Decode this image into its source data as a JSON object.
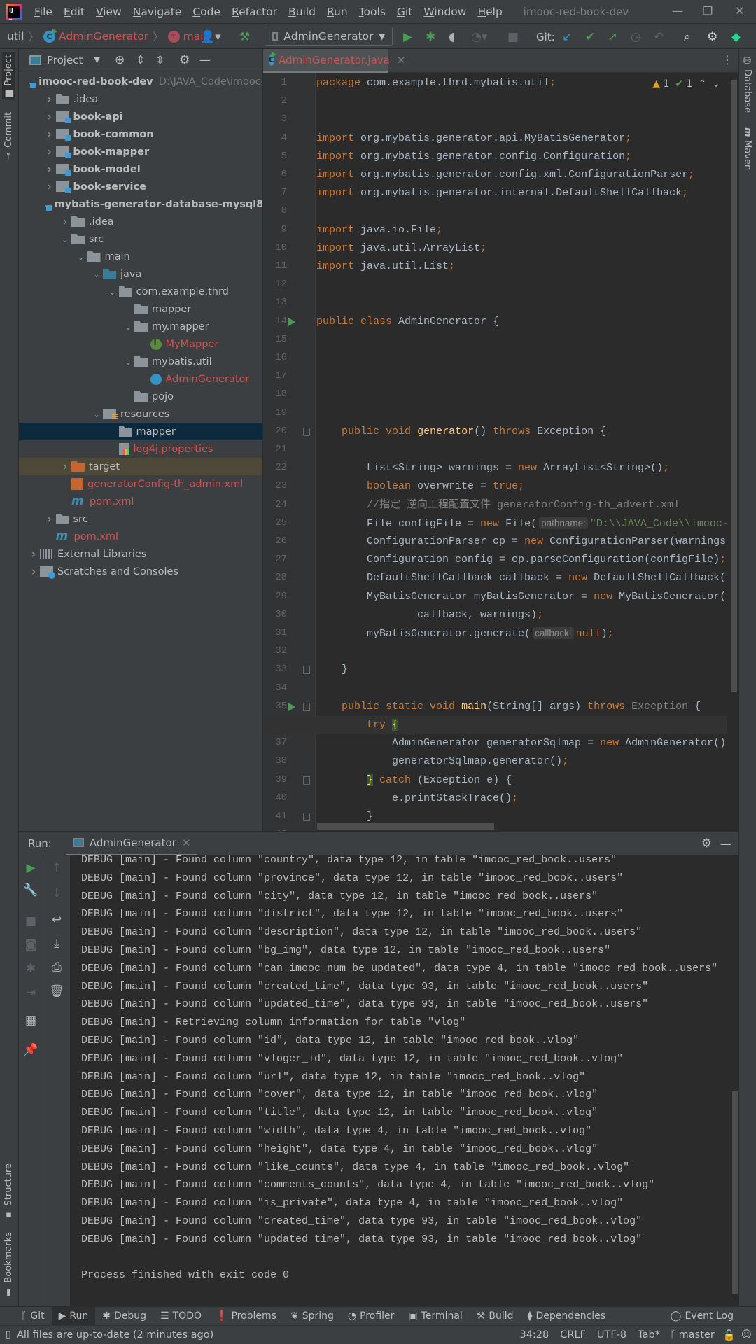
{
  "window": {
    "title": "imooc-red-book-dev"
  },
  "menu": [
    "File",
    "Edit",
    "View",
    "Navigate",
    "Code",
    "Refactor",
    "Build",
    "Run",
    "Tools",
    "Git",
    "Window",
    "Help"
  ],
  "breadcrumb": {
    "package": "util",
    "class": "AdminGenerator",
    "method": "main"
  },
  "toolbar": {
    "run_config": "AdminGenerator",
    "git_label": "Git:"
  },
  "left_stripe": {
    "project": "Project",
    "commit": "Commit",
    "structure": "Structure",
    "bookmarks": "Bookmarks"
  },
  "right_stripe": {
    "database": "Database",
    "maven": "Maven"
  },
  "project_panel": {
    "title": "Project",
    "tree": [
      {
        "label": "imooc-red-book-dev",
        "hint": "D:\\JAVA_Code\\imooc-red-book-dev",
        "level": 0,
        "arrow": "open",
        "icon": "root",
        "style": "bold"
      },
      {
        "label": ".idea",
        "level": 1,
        "arrow": "closed",
        "icon": "folder"
      },
      {
        "label": "book-api",
        "level": 1,
        "arrow": "closed",
        "icon": "module",
        "style": "bold"
      },
      {
        "label": "book-common",
        "level": 1,
        "arrow": "closed",
        "icon": "module",
        "style": "bold"
      },
      {
        "label": "book-mapper",
        "level": 1,
        "arrow": "closed",
        "icon": "module",
        "style": "bold"
      },
      {
        "label": "book-model",
        "level": 1,
        "arrow": "closed",
        "icon": "module",
        "style": "bold"
      },
      {
        "label": "book-service",
        "level": 1,
        "arrow": "closed",
        "icon": "module",
        "style": "bold"
      },
      {
        "label": "mybatis-generator-database-mysql8",
        "level": 1,
        "arrow": "open",
        "icon": "module",
        "style": "bold"
      },
      {
        "label": ".idea",
        "level": 2,
        "arrow": "closed",
        "icon": "folder"
      },
      {
        "label": "src",
        "level": 2,
        "arrow": "open",
        "icon": "folder"
      },
      {
        "label": "main",
        "level": 3,
        "arrow": "open",
        "icon": "folder"
      },
      {
        "label": "java",
        "level": 4,
        "arrow": "open",
        "icon": "src"
      },
      {
        "label": "com.example.thrd",
        "level": 5,
        "arrow": "open",
        "icon": "pkg"
      },
      {
        "label": "mapper",
        "level": 6,
        "arrow": "none",
        "icon": "pkg"
      },
      {
        "label": "my.mapper",
        "level": 6,
        "arrow": "open",
        "icon": "pkg"
      },
      {
        "label": "MyMapper",
        "level": 7,
        "arrow": "none",
        "icon": "iface",
        "style": "red"
      },
      {
        "label": "mybatis.util",
        "level": 6,
        "arrow": "open",
        "icon": "pkg"
      },
      {
        "label": "AdminGenerator",
        "level": 7,
        "arrow": "none",
        "icon": "cls",
        "style": "red"
      },
      {
        "label": "pojo",
        "level": 6,
        "arrow": "none",
        "icon": "pkg"
      },
      {
        "label": "resources",
        "level": 4,
        "arrow": "open",
        "icon": "res"
      },
      {
        "label": "mapper",
        "level": 5,
        "arrow": "none",
        "icon": "folder",
        "state": "selected"
      },
      {
        "label": "log4j.properties",
        "level": 5,
        "arrow": "none",
        "icon": "props",
        "style": "red"
      },
      {
        "label": "target",
        "level": 2,
        "arrow": "closed",
        "icon": "target",
        "state": "ignored"
      },
      {
        "label": "generatorConfig-th_admin.xml",
        "level": 2,
        "arrow": "none",
        "icon": "xml",
        "style": "red"
      },
      {
        "label": "pom.xml",
        "level": 2,
        "arrow": "none",
        "icon": "maven",
        "style": "red"
      },
      {
        "label": "src",
        "level": 1,
        "arrow": "closed",
        "icon": "folder"
      },
      {
        "label": "pom.xml",
        "level": 1,
        "arrow": "none",
        "icon": "maven",
        "style": "red"
      },
      {
        "label": "External Libraries",
        "level": 0,
        "arrow": "closed",
        "icon": "libs"
      },
      {
        "label": "Scratches and Consoles",
        "level": 0,
        "arrow": "closed",
        "icon": "scratch"
      }
    ]
  },
  "editor": {
    "tab": "AdminGenerator.java",
    "inspections": {
      "warnings": "1",
      "typos": "1"
    },
    "current_line": 36,
    "run_gutter_lines": [
      14,
      35
    ],
    "fold_lines": [
      20,
      33,
      35,
      36,
      39,
      41
    ],
    "lines": [
      [
        [
          "k",
          "package"
        ],
        [
          "t",
          " com.example.thrd.mybatis.util"
        ],
        [
          "k",
          ";"
        ]
      ],
      [],
      [],
      [
        [
          "k",
          "import"
        ],
        [
          "t",
          " org.mybatis.generator.api.MyBatisGenerator"
        ],
        [
          "k",
          ";"
        ]
      ],
      [
        [
          "k",
          "import"
        ],
        [
          "t",
          " org.mybatis.generator.config.Configuration"
        ],
        [
          "k",
          ";"
        ]
      ],
      [
        [
          "k",
          "import"
        ],
        [
          "t",
          " org.mybatis.generator.config.xml.ConfigurationParser"
        ],
        [
          "k",
          ";"
        ]
      ],
      [
        [
          "k",
          "import"
        ],
        [
          "t",
          " org.mybatis.generator.internal.DefaultShellCallback"
        ],
        [
          "k",
          ";"
        ]
      ],
      [],
      [
        [
          "k",
          "import"
        ],
        [
          "t",
          " java.io.File"
        ],
        [
          "k",
          ";"
        ]
      ],
      [
        [
          "k",
          "import"
        ],
        [
          "t",
          " java.util.ArrayList"
        ],
        [
          "k",
          ";"
        ]
      ],
      [
        [
          "k",
          "import"
        ],
        [
          "t",
          " java.util.List"
        ],
        [
          "k",
          ";"
        ]
      ],
      [],
      [],
      [
        [
          "k",
          "public class"
        ],
        [
          "t",
          " AdminGenerator {"
        ]
      ],
      [],
      [],
      [],
      [],
      [],
      [
        [
          "t",
          "    "
        ],
        [
          "k",
          "public void"
        ],
        [
          "t",
          " "
        ],
        [
          "f",
          "generator"
        ],
        [
          "t",
          "() "
        ],
        [
          "k",
          "throws"
        ],
        [
          "t",
          " Exception {"
        ]
      ],
      [],
      [
        [
          "t",
          "        List<String> warnings = "
        ],
        [
          "k",
          "new"
        ],
        [
          "t",
          " ArrayList<String>()"
        ],
        [
          "k",
          ";"
        ]
      ],
      [
        [
          "t",
          "        "
        ],
        [
          "k",
          "boolean"
        ],
        [
          "t",
          " overwrite = "
        ],
        [
          "k",
          "true;"
        ]
      ],
      [
        [
          "c",
          "        //指定 逆向工程配置文件 generatorConfig-th_advert.xml"
        ]
      ],
      [
        [
          "t",
          "        File configFile = "
        ],
        [
          "k",
          "new"
        ],
        [
          "t",
          " File("
        ],
        [
          "h",
          "pathname:"
        ],
        [
          "s",
          "\"D:\\\\JAVA_Code\\\\imooc-red"
        ]
      ],
      [
        [
          "t",
          "        ConfigurationParser cp = "
        ],
        [
          "k",
          "new"
        ],
        [
          "t",
          " ConfigurationParser(warnings)"
        ],
        [
          "k",
          ";"
        ]
      ],
      [
        [
          "t",
          "        Configuration config = cp.parseConfiguration(configFile)"
        ],
        [
          "k",
          ";"
        ]
      ],
      [
        [
          "t",
          "        DefaultShellCallback callback = "
        ],
        [
          "k",
          "new"
        ],
        [
          "t",
          " DefaultShellCallback(overwrite)"
        ]
      ],
      [
        [
          "t",
          "        MyBatisGenerator myBatisGenerator = "
        ],
        [
          "k",
          "new"
        ],
        [
          "t",
          " MyBatisGenerator(config,"
        ]
      ],
      [
        [
          "t",
          "                callback, warnings)"
        ],
        [
          "k",
          ";"
        ]
      ],
      [
        [
          "t",
          "        myBatisGenerator.generate("
        ],
        [
          "h",
          "callback:"
        ],
        [
          "k",
          "null"
        ],
        [
          "t",
          ")"
        ],
        [
          "k",
          ";"
        ]
      ],
      [],
      [
        [
          "t",
          "    }"
        ]
      ],
      [],
      [
        [
          "t",
          "    "
        ],
        [
          "k",
          "public static void"
        ],
        [
          "t",
          " "
        ],
        [
          "f",
          "main"
        ],
        [
          "t",
          "(String[] args) "
        ],
        [
          "k",
          "throws"
        ],
        [
          "g",
          " Exception"
        ],
        [
          "t",
          " {"
        ]
      ],
      [
        [
          "t",
          "        "
        ],
        [
          "k",
          "try"
        ],
        [
          "t",
          " "
        ],
        [
          "y",
          "{"
        ]
      ],
      [
        [
          "t",
          "            AdminGenerator generatorSqlmap = "
        ],
        [
          "k",
          "new"
        ],
        [
          "t",
          " AdminGenerator()"
        ],
        [
          "k",
          ";"
        ]
      ],
      [
        [
          "t",
          "            generatorSqlmap.generator()"
        ],
        [
          "k",
          ";"
        ]
      ],
      [
        [
          "t",
          "        "
        ],
        [
          "y",
          "}"
        ],
        [
          "k",
          " catch"
        ],
        [
          "t",
          " (Exception e) {"
        ]
      ],
      [
        [
          "t",
          "            e.printStackTrace()"
        ],
        [
          "k",
          ";"
        ]
      ],
      [
        [
          "t",
          "        }"
        ]
      ],
      []
    ]
  },
  "run_panel": {
    "label": "Run:",
    "tab": "AdminGenerator",
    "output": [
      "DEBUG [main] - Found column \"country\", data type 12, in table \"imooc_red_book..users\"",
      "DEBUG [main] - Found column \"province\", data type 12, in table \"imooc_red_book..users\"",
      "DEBUG [main] - Found column \"city\", data type 12, in table \"imooc_red_book..users\"",
      "DEBUG [main] - Found column \"district\", data type 12, in table \"imooc_red_book..users\"",
      "DEBUG [main] - Found column \"description\", data type 12, in table \"imooc_red_book..users\"",
      "DEBUG [main] - Found column \"bg_img\", data type 12, in table \"imooc_red_book..users\"",
      "DEBUG [main] - Found column \"can_imooc_num_be_updated\", data type 4, in table \"imooc_red_book..users\"",
      "DEBUG [main] - Found column \"created_time\", data type 93, in table \"imooc_red_book..users\"",
      "DEBUG [main] - Found column \"updated_time\", data type 93, in table \"imooc_red_book..users\"",
      "DEBUG [main] - Retrieving column information for table \"vlog\"",
      "DEBUG [main] - Found column \"id\", data type 12, in table \"imooc_red_book..vlog\"",
      "DEBUG [main] - Found column \"vloger_id\", data type 12, in table \"imooc_red_book..vlog\"",
      "DEBUG [main] - Found column \"url\", data type 12, in table \"imooc_red_book..vlog\"",
      "DEBUG [main] - Found column \"cover\", data type 12, in table \"imooc_red_book..vlog\"",
      "DEBUG [main] - Found column \"title\", data type 12, in table \"imooc_red_book..vlog\"",
      "DEBUG [main] - Found column \"width\", data type 4, in table \"imooc_red_book..vlog\"",
      "DEBUG [main] - Found column \"height\", data type 4, in table \"imooc_red_book..vlog\"",
      "DEBUG [main] - Found column \"like_counts\", data type 4, in table \"imooc_red_book..vlog\"",
      "DEBUG [main] - Found column \"comments_counts\", data type 4, in table \"imooc_red_book..vlog\"",
      "DEBUG [main] - Found column \"is_private\", data type 4, in table \"imooc_red_book..vlog\"",
      "DEBUG [main] - Found column \"created_time\", data type 93, in table \"imooc_red_book..vlog\"",
      "DEBUG [main] - Found column \"updated_time\", data type 93, in table \"imooc_red_book..vlog\"",
      "",
      "Process finished with exit code 0"
    ]
  },
  "bottom_tools": [
    {
      "label": "Git",
      "icon": "git-branch-icon",
      "glyph": "ᚴ"
    },
    {
      "label": "Run",
      "icon": "run-icon",
      "glyph": "▶",
      "active": true
    },
    {
      "label": "Debug",
      "icon": "bug-icon",
      "glyph": "✱"
    },
    {
      "label": "TODO",
      "icon": "list-icon",
      "glyph": "☰"
    },
    {
      "label": "Problems",
      "icon": "problems-icon",
      "glyph": "❗"
    },
    {
      "label": "Spring",
      "icon": "spring-leaf-icon",
      "glyph": "❦"
    },
    {
      "label": "Profiler",
      "icon": "profiler-icon",
      "glyph": "◔"
    },
    {
      "label": "Terminal",
      "icon": "terminal-icon",
      "glyph": "▣"
    },
    {
      "label": "Build",
      "icon": "hammer-icon",
      "glyph": "⚒"
    },
    {
      "label": "Dependencies",
      "icon": "dependencies-icon",
      "glyph": "⧫"
    }
  ],
  "event_log": "Event Log",
  "status": {
    "message": "All files are up-to-date (2 minutes ago)",
    "position": "34:28",
    "line_ending": "CRLF",
    "encoding": "UTF-8",
    "indent": "Tab*",
    "branch": "master"
  }
}
